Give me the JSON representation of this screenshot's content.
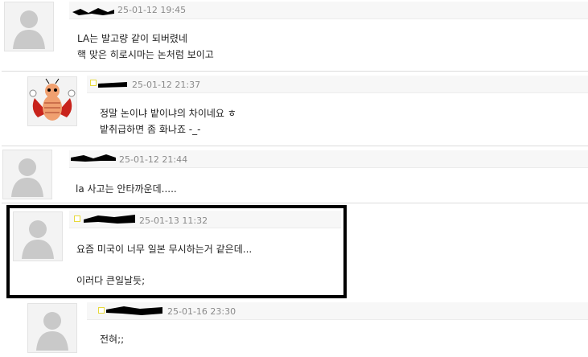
{
  "comments": [
    {
      "timestamp": "25-01-12 19:45",
      "lines": [
        "LA는 발고량 같이 되버렸네",
        "핵 맞은 히로시마는 논처럼 보이고"
      ]
    },
    {
      "timestamp": "25-01-12 21:37",
      "lines": [
        "정말 논이냐 밭이냐의 차이네요 ㅎ",
        "밭취급하면 좀 화나죠 -_-"
      ]
    },
    {
      "timestamp": "25-01-12 21:44",
      "lines": [
        "la 사고는 안타까운데....."
      ]
    },
    {
      "timestamp": "25-01-13 11:32",
      "lines": [
        "요즘 미국이 너무 일본 무시하는거 같은데...",
        "이러다 큰일날듯;"
      ]
    },
    {
      "timestamp": "25-01-16 23:30",
      "lines": [
        "전혀;;"
      ]
    }
  ],
  "icons": {
    "default_avatar": "default-user-avatar-icon",
    "bug_avatar": "ladybug-avatar-icon"
  },
  "colors": {
    "highlight_border": "#000000",
    "timestamp": "#8a8a8a",
    "header_bg": "#f7f7f7"
  }
}
